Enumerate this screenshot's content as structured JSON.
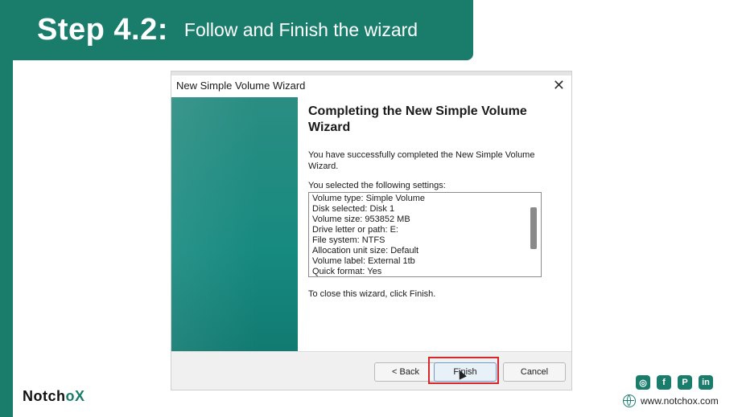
{
  "banner": {
    "step": "Step 4.2:",
    "subtitle": "Follow and Finish the wizard"
  },
  "wizard": {
    "title": "New Simple Volume Wizard",
    "close_icon": "close-icon",
    "heading": "Completing the New Simple Volume Wizard",
    "description": "You have successfully completed the New Simple Volume Wizard.",
    "settings_label": "You selected the following settings:",
    "settings": [
      "Volume type: Simple Volume",
      "Disk selected: Disk 1",
      "Volume size: 953852 MB",
      "Drive letter or path: E:",
      "File system: NTFS",
      "Allocation unit size: Default",
      "Volume label: External 1tb",
      "Quick format: Yes"
    ],
    "close_instruction": "To close this wizard, click Finish.",
    "buttons": {
      "back": "< Back",
      "finish": "Finish",
      "cancel": "Cancel"
    }
  },
  "footer": {
    "logo_prefix": "Notch",
    "logo_x": "oX",
    "website": "www.notchox.com",
    "social_icons": [
      "instagram-icon",
      "facebook-icon",
      "pinterest-icon",
      "linkedin-icon"
    ]
  },
  "colors": {
    "brand": "#1a7d6c",
    "highlight": "#d6262e"
  }
}
